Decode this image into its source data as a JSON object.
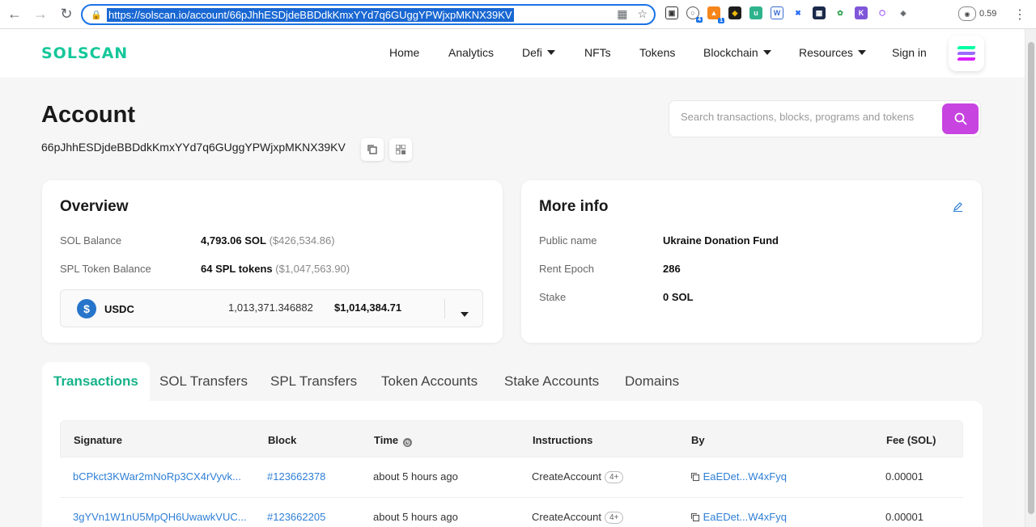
{
  "browser": {
    "url": "https://solscan.io/account/66pJhhESDjdeBBDdkKmxYYd7q6GUggYPWjxpMKNX39KV",
    "extension_badge_1": "4",
    "extension_badge_2": "1",
    "extension_counter": "0.59"
  },
  "header": {
    "logo": "SOLSCAN",
    "nav": {
      "home": "Home",
      "analytics": "Analytics",
      "defi": "Defi",
      "nfts": "NFTs",
      "tokens": "Tokens",
      "blockchain": "Blockchain",
      "resources": "Resources",
      "sign_in": "Sign in"
    }
  },
  "account": {
    "title": "Account",
    "address": "66pJhhESDjdeBBDdkKmxYYd7q6GUggYPWjxpMKNX39KV"
  },
  "search": {
    "placeholder": "Search transactions, blocks, programs and tokens"
  },
  "overview": {
    "title": "Overview",
    "sol_balance_label": "SOL Balance",
    "sol_balance_value": "4,793.06 SOL",
    "sol_balance_usd": "($426,534.86)",
    "spl_label": "SPL Token Balance",
    "spl_value": "64 SPL tokens",
    "spl_usd": "($1,047,563.90)",
    "token": {
      "symbol": "USDC",
      "amount": "1,013,371.346882",
      "usd": "$1,014,384.71"
    }
  },
  "more_info": {
    "title": "More info",
    "public_name_label": "Public name",
    "public_name_value": "Ukraine Donation Fund",
    "rent_epoch_label": "Rent Epoch",
    "rent_epoch_value": "286",
    "stake_label": "Stake",
    "stake_value": "0 SOL"
  },
  "tabs": {
    "transactions": "Transactions",
    "sol_transfers": "SOL Transfers",
    "spl_transfers": "SPL Transfers",
    "token_accounts": "Token Accounts",
    "stake_accounts": "Stake Accounts",
    "domains": "Domains"
  },
  "table": {
    "headers": {
      "signature": "Signature",
      "block": "Block",
      "time": "Time",
      "instructions": "Instructions",
      "by": "By",
      "fee": "Fee (SOL)"
    },
    "rows": [
      {
        "signature": "bCPkct3KWar2mNoRp3CX4rVyvk...",
        "block": "#123662378",
        "time": "about 5 hours ago",
        "instruction": "CreateAccount",
        "extra": "4+",
        "by": "EaEDet...W4xFyq",
        "fee": "0.00001"
      },
      {
        "signature": "3gYVn1W1nU5MpQH6UwawkVUC...",
        "block": "#123662205",
        "time": "about 5 hours ago",
        "instruction": "CreateAccount",
        "extra": "4+",
        "by": "EaEDet...W4xFyq",
        "fee": "0.00001"
      }
    ]
  },
  "colors": {
    "brand_green": "#16c79a",
    "search_purple": "#c744e0",
    "link_blue": "#2f7fd6"
  }
}
